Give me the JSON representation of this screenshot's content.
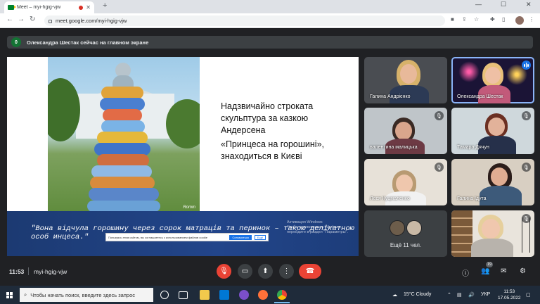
{
  "browser": {
    "tab_title": "Meet – myi-hgig-vjw",
    "url": "meet.google.com/myi-hgig-vjw",
    "new_tab": "+",
    "window_controls": [
      "—",
      "☐",
      "✕"
    ]
  },
  "notification": {
    "badge": "0",
    "text": "Олександра Шестак сейчас на главном экране"
  },
  "slide": {
    "text_lines": [
      "Надзвичайно строката",
      "скульптура за казкою",
      "Андерсена"
    ],
    "text_lines_2": [
      "«Принцеса на горошині»,",
      "знаходиться в Києві"
    ],
    "quote": "\"Вона відчула горошину через сорок матраців та перинок – такою делікатною особ                                                   инцеса.\"",
    "watermark": "Romm",
    "activate_line1": "Активация Windows",
    "activate_line2": "Чтобы активировать Windows, перейдите в раздел \"Параметры\".",
    "cookie_text": "Пользуясь этим сайтом, вы соглашаетесь с использованием файлов cookie",
    "cookie_accept": "Согласиться",
    "cookie_more": "Ещё"
  },
  "participants": [
    {
      "name": "Галина Андрієнко",
      "muted": false,
      "speaking": false
    },
    {
      "name": "Олександра Шестак",
      "muted": false,
      "speaking": true
    },
    {
      "name": "валентина малицька",
      "muted": true,
      "speaking": false
    },
    {
      "name": "Тамара Дячун",
      "muted": true,
      "speaking": false
    },
    {
      "name": "Леся Куцмаленко",
      "muted": true,
      "speaking": false
    },
    {
      "name": "Галина Ідута",
      "muted": true,
      "speaking": false
    },
    {
      "name": "",
      "muted": true,
      "speaking": false
    }
  ],
  "more_tile": {
    "label": "Ещё 11 чел."
  },
  "bottom_bar": {
    "time": "11:53",
    "meeting_code": "myi-hgig-vjw",
    "people_count": "19"
  },
  "taskbar": {
    "search_placeholder": "Чтобы начать поиск, введите здесь запрос",
    "weather": "15°C  Cloudy",
    "language": "УКР",
    "time": "11:53",
    "date": "17.05.2022"
  },
  "colors": {
    "meet_bg": "#202124",
    "end_call": "#ea4335",
    "active_speaker": "#8ab4f8",
    "banner": "#1c3a72"
  }
}
